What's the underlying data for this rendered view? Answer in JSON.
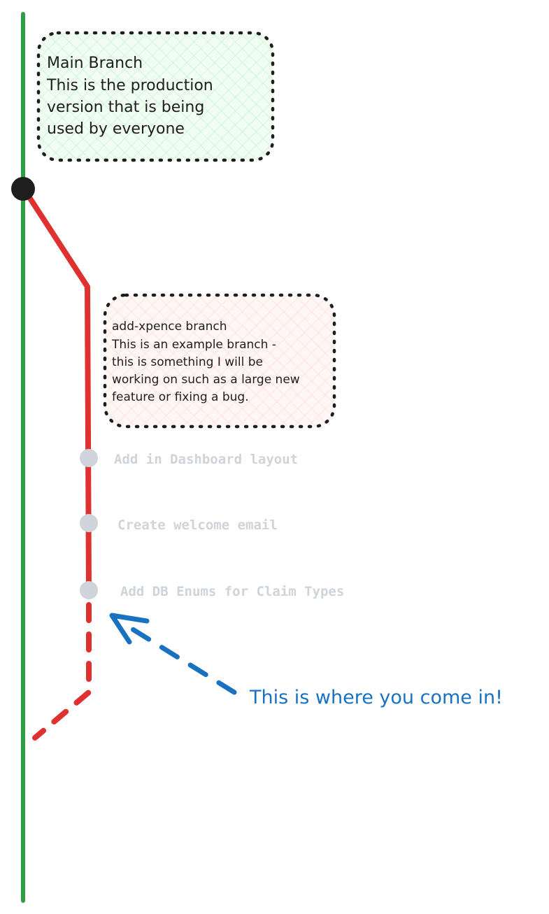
{
  "colors": {
    "main_branch": "#2f9e44",
    "feature_branch": "#e03131",
    "commit_dot": "#ced4da",
    "merge_dot": "#1e1e1e",
    "callout": "#1971c2",
    "main_note_fill": "#d3f9d8",
    "feature_note_fill": "#ffe3e3",
    "note_border": "#1e1e1e"
  },
  "main_note": {
    "lines": [
      "Main Branch",
      "This is the production",
      "version that is being",
      "used by everyone"
    ]
  },
  "feature_note": {
    "lines": [
      "add-xpence branch",
      "This is an example branch -",
      "this is something I will be",
      "working on such as a large new",
      "feature or fixing a bug."
    ]
  },
  "commits": [
    "Add in Dashboard layout",
    "Create welcome email",
    "Add DB Enums for Claim Types"
  ],
  "callout": {
    "text": "This is where you come in!",
    "icon": "dashed-arrow-icon"
  }
}
